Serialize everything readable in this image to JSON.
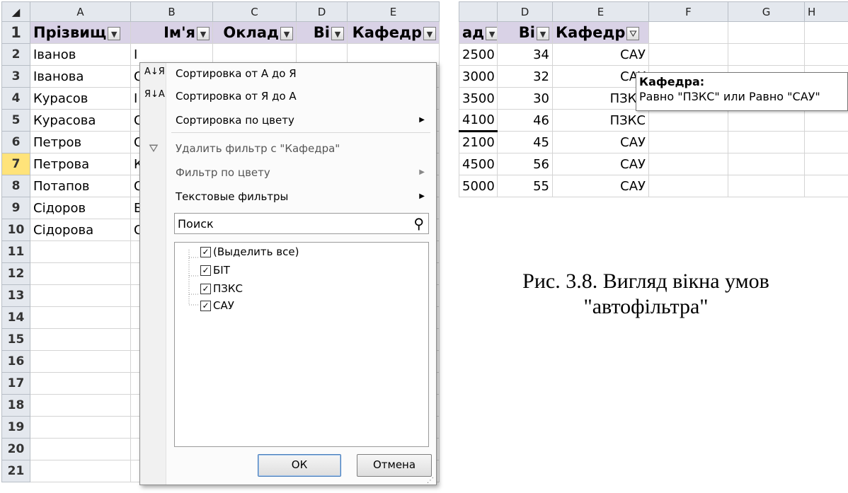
{
  "left_sheet": {
    "columns": [
      "A",
      "B",
      "C",
      "D",
      "E"
    ],
    "header": {
      "row_num": "1",
      "cells": [
        "Прізвищ",
        "Ім'я",
        "Оклад",
        "Ві",
        "Кафедр"
      ]
    },
    "rows": [
      {
        "num": "2",
        "a": "Іванов",
        "b": "І"
      },
      {
        "num": "3",
        "a": "Іванова",
        "b": "О"
      },
      {
        "num": "4",
        "a": "Курасов",
        "b": "І"
      },
      {
        "num": "5",
        "a": "Курасова",
        "b": "О"
      },
      {
        "num": "6",
        "a": "Петров",
        "b": "О"
      },
      {
        "num": "7",
        "a": "Петрова",
        "b": "К"
      },
      {
        "num": "8",
        "a": "Потапов",
        "b": "О"
      },
      {
        "num": "9",
        "a": "Сідоров",
        "b": "Б"
      },
      {
        "num": "10",
        "a": "Сідорова",
        "b": "О"
      },
      {
        "num": "11",
        "a": "",
        "b": ""
      },
      {
        "num": "12",
        "a": "",
        "b": ""
      },
      {
        "num": "13",
        "a": "",
        "b": ""
      },
      {
        "num": "14",
        "a": "",
        "b": ""
      },
      {
        "num": "15",
        "a": "",
        "b": ""
      },
      {
        "num": "16",
        "a": "",
        "b": ""
      },
      {
        "num": "17",
        "a": "",
        "b": ""
      },
      {
        "num": "18",
        "a": "",
        "b": ""
      },
      {
        "num": "19",
        "a": "",
        "b": ""
      },
      {
        "num": "20",
        "a": "",
        "b": ""
      },
      {
        "num": "21",
        "a": "",
        "b": ""
      }
    ],
    "selected_row": "7",
    "selected_column": "C"
  },
  "filter_menu": {
    "sort_az_icon": "А↓Я",
    "sort_az": "Сортировка от А до Я",
    "sort_za_icon": "Я↓А",
    "sort_za": "Сортировка от Я до А",
    "sort_color": "Сортировка по цвету",
    "clear_filter_icon": "clear-filter",
    "clear_filter": "Удалить фильтр с \"Кафедра\"",
    "filter_color": "Фильтр по цвету",
    "text_filters": "Текстовые фильтры",
    "search_placeholder": "Поиск",
    "tree": [
      "(Выделить все)",
      "БІТ",
      "ПЗКС",
      "САУ"
    ],
    "ok": "ОК",
    "cancel": "Отмена"
  },
  "right_sheet": {
    "columns": [
      "",
      "D",
      "E",
      "F",
      "G",
      "H"
    ],
    "header": [
      "ад",
      "Ві",
      "Кафедр"
    ],
    "rows": [
      {
        "c": "2500",
        "d": "34",
        "e": "САУ"
      },
      {
        "c": "3000",
        "d": "32",
        "e": "САУ"
      },
      {
        "c": "3500",
        "d": "30",
        "e": "ПЗКС"
      },
      {
        "c": "4100",
        "d": "46",
        "e": "ПЗКС"
      },
      {
        "c": "2100",
        "d": "45",
        "e": "САУ"
      },
      {
        "c": "4500",
        "d": "56",
        "e": "САУ"
      },
      {
        "c": "5000",
        "d": "55",
        "e": "САУ"
      }
    ]
  },
  "tooltip": {
    "title": "Кафедра:",
    "text": "Равно \"ПЗКС\" или Равно \"САУ\""
  },
  "caption": {
    "line1": "Рис. 3.8. Вигляд вікна умов",
    "line2": "\"автофільтра\""
  },
  "colors": {
    "header_fill": "#d9d2e6",
    "selected_header": "#ffe37a",
    "grid_header": "#e4e8ee"
  }
}
